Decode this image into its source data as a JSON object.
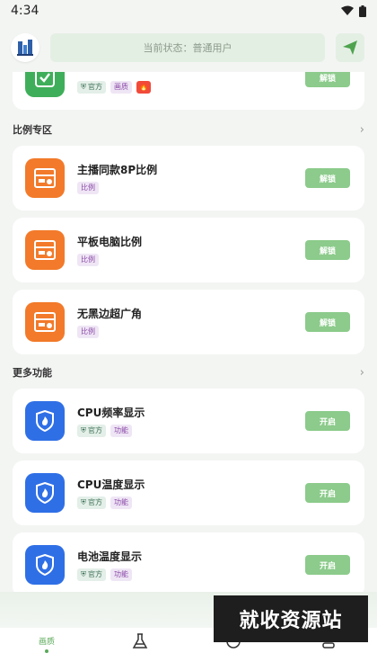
{
  "status_bar": {
    "time": "4:34"
  },
  "header": {
    "status_text": "当前状态：普通用户"
  },
  "top_partial_card": {
    "tags": [
      "官方",
      "画质"
    ],
    "action": "解锁",
    "icon_color": "#3fae5a"
  },
  "sections": [
    {
      "title": "比例专区",
      "items": [
        {
          "title": "主播同款8P比例",
          "tags": [
            "比例"
          ],
          "action": "解锁"
        },
        {
          "title": "平板电脑比例",
          "tags": [
            "比例"
          ],
          "action": "解锁"
        },
        {
          "title": "无黑边超广角",
          "tags": [
            "比例"
          ],
          "action": "解锁"
        }
      ]
    },
    {
      "title": "更多功能",
      "items": [
        {
          "title": "CPU频率显示",
          "tags": [
            "官方",
            "功能"
          ],
          "action": "开启"
        },
        {
          "title": "CPU温度显示",
          "tags": [
            "官方",
            "功能"
          ],
          "action": "开启"
        },
        {
          "title": "电池温度显示",
          "tags": [
            "官方",
            "功能"
          ],
          "action": "开启"
        }
      ]
    }
  ],
  "tabs": [
    {
      "label": "画质",
      "icon": "quality-icon",
      "active": true
    },
    {
      "label": "",
      "icon": "flask-icon"
    },
    {
      "label": "",
      "icon": "leaf-icon"
    },
    {
      "label": "",
      "icon": "profile-icon"
    }
  ],
  "watermark": "就收资源站",
  "colors": {
    "accent": "#8ccb8b",
    "ratio_icon": "#f27a2a",
    "feature_icon": "#2f6fe6",
    "check_icon": "#3fae5a"
  }
}
